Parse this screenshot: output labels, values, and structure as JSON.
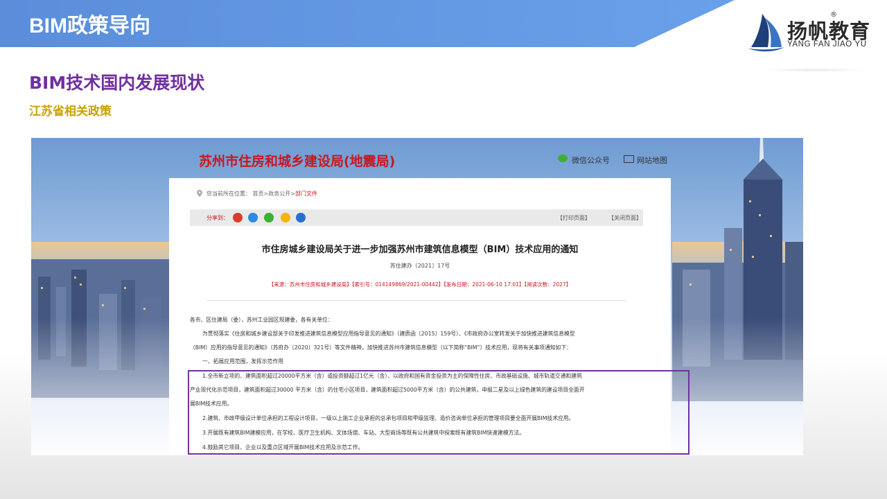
{
  "header": {
    "title": "BIM政策导向",
    "banner_color": "#5b8fde"
  },
  "logo": {
    "name_cn": "扬帆教育",
    "registered": "®",
    "name_en": "YANG FAN JIAO YU"
  },
  "section_title": "BIM技术国内发展现状",
  "sub_title": "江苏省相关政策",
  "webpage": {
    "site_title": "苏州市住房和城乡建设局(地震局)",
    "wechat_label": "微信公众号",
    "sitemap_label": "网站地图",
    "breadcrumb_prefix": "您当前所在位置： 首页>政务公开>",
    "breadcrumb_current": "部门文件",
    "share_label": "分享到：",
    "print_label": "【打印页面】",
    "close_label": "【关闭页面】",
    "doc_title": "市住房城乡建设局关于进一步加强苏州市建筑信息模型（BIM）技术应用的通知",
    "doc_number": "苏住建办〔2021〕17号",
    "doc_meta": "【来源：苏州市住房和城乡建设局】【索引号：014149869/2021-00442】【发布日期：2021-06-10 17:01】【阅读次数：2027】",
    "paragraphs": [
      "各市、区住建局（委），苏州工业园区规建委，各有关单位：",
      "为贯彻落实《住房和城乡建设部关于印发推进建筑信息模型应用指导意见的通知》（建质函〔2015〕159号）、《市政府办公室转发关于加快推进建筑信息模型",
      "（BIM）应用的指导意见的通知》（苏府办〔2020〕321号）等文件精神，加快推进苏州市建筑信息模型（以下简称“BIM”）技术应用，现将有关事项通知如下：",
      "一、拓展应用范围，发挥示范作用",
      "1.全市新立项的、建筑面积超过20000平方米（含）或投资额超过1亿元（含）、以政府和国有资金投资为主的保障性住房、市政基础设施、城市轨道交通和建筑",
      "产业现代化示范项目，建筑面积超过30000  平方米（含）的住宅小区项目，建筑面积超过5000平方米（含）的公共建筑，申报二星及以上绿色建筑的建设项目全面开",
      "展BIM技术应用。",
      "2.建筑、市政甲级设计单位承担的工程设计项目，一级以上施工企业承担的总承包项目和甲级监理、造价咨询单位承担的管理项目要全面开展BIM技术应用。",
      "3.开展既有建筑BIM建模应用，在学校、医疗卫生机构、文体场馆、车站、大型商场等既有公共建筑中探索既有建筑BIM快速建模方法。",
      "4.鼓励其它项目、企业以及重点区域开展BIM技术应用及示范工作。"
    ]
  },
  "highlight_color": "#7030a0"
}
